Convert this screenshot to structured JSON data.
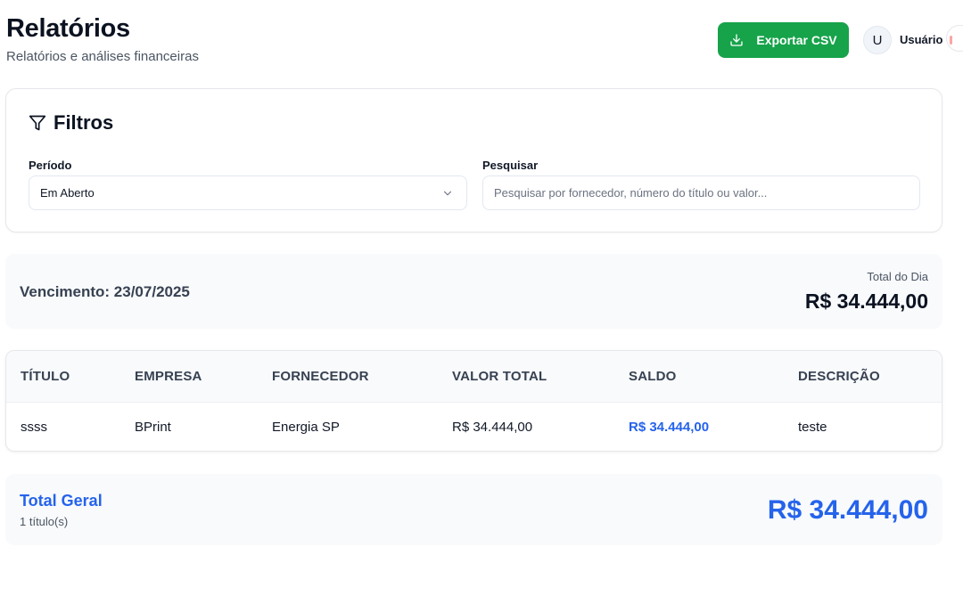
{
  "header": {
    "title": "Relatórios",
    "subtitle": "Relatórios e análises financeiras",
    "export_label": "Exportar CSV",
    "avatar_initial": "U",
    "user_name": "Usuário"
  },
  "filters": {
    "title": "Filtros",
    "period_label": "Período",
    "period_value": "Em Aberto",
    "search_label": "Pesquisar",
    "search_placeholder": "Pesquisar por fornecedor, número do título ou valor...",
    "search_value": ""
  },
  "due_group": {
    "label": "Vencimento: 23/07/2025",
    "day_total_label": "Total do Dia",
    "day_total_value": "R$ 34.444,00"
  },
  "table": {
    "columns": [
      "TÍTULO",
      "EMPRESA",
      "FORNECEDOR",
      "VALOR TOTAL",
      "SALDO",
      "DESCRIÇÃO"
    ],
    "rows": [
      {
        "titulo": "ssss",
        "empresa": "BPrint",
        "fornecedor": "Energia SP",
        "valor_total": "R$ 34.444,00",
        "saldo": "R$ 34.444,00",
        "descricao": "teste"
      }
    ]
  },
  "summary": {
    "label": "Total Geral",
    "count": "1 título(s)",
    "value": "R$ 34.444,00"
  },
  "colors": {
    "export_button": "#16a34a",
    "accent_blue": "#2563eb"
  },
  "icons": {
    "export": "download-icon",
    "filters": "filter-icon",
    "select": "chevron-down-icon"
  }
}
